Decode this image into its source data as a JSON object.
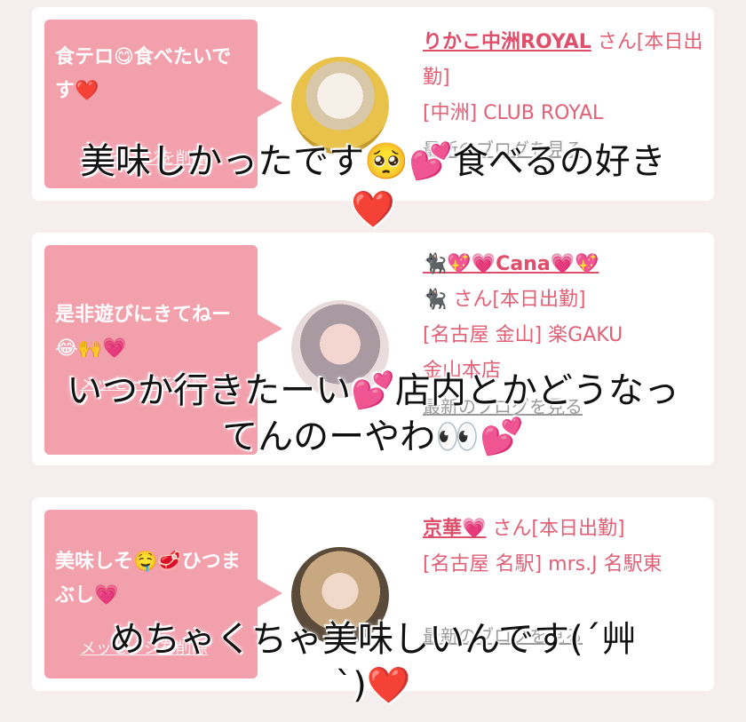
{
  "cards": [
    {
      "bubble_text": "食テロ😋食べたいです❤️",
      "delete_label": "メッセージを削除",
      "name": "りかこ中洲ROYAL",
      "suffix": "さん[本日出勤]",
      "shop": "[中洲] CLUB ROYAL",
      "blog_label": "最新のブログを見る"
    },
    {
      "bubble_text": "是非遊びにきてねー😂🙌💗",
      "delete_label": "メッセージを削除",
      "name": "🐈‍⬛💖💗Cana💗💖",
      "suffix": "🐈‍⬛ さん[本日出勤]",
      "shop": "[名古屋 金山] 楽GAKU",
      "shop2": "金山本店",
      "blog_label": "最新のブログを見る"
    },
    {
      "bubble_text": "美味しそ🤤🥩ひつまぶし💗",
      "delete_label": "メッセージを削除",
      "name": "京華💗",
      "suffix": "さん[本日出勤]",
      "shop": "[名古屋 名駅] mrs.J 名駅東",
      "blog_label": "最新のブログを見る"
    }
  ],
  "captions": {
    "c1_line1": "美味しかったです🥺💕食べるの好き",
    "c1_line2": "❤️",
    "c2_line1": "いつか行きたーい💕店内とかどうなっ",
    "c2_line2": "てんのーやわ👀💕",
    "c3_line1": "めちゃくちゃ美味しいんです(´艸",
    "c3_line2": "`)❤️"
  }
}
